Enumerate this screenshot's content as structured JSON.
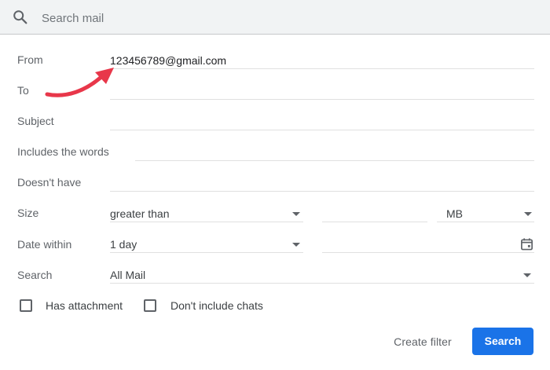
{
  "search": {
    "placeholder": "Search mail"
  },
  "fields": {
    "from": {
      "label": "From",
      "value": "123456789@gmail.com"
    },
    "to": {
      "label": "To",
      "value": ""
    },
    "subject": {
      "label": "Subject",
      "value": ""
    },
    "includes": {
      "label": "Includes the words",
      "value": ""
    },
    "doesnt_have": {
      "label": "Doesn't have",
      "value": ""
    },
    "size": {
      "label": "Size",
      "operator": "greater than",
      "value": "",
      "unit": "MB"
    },
    "date": {
      "label": "Date within",
      "range": "1 day",
      "value": ""
    },
    "search_in": {
      "label": "Search",
      "value": "All Mail"
    }
  },
  "checkboxes": {
    "has_attachment": {
      "label": "Has attachment",
      "checked": false
    },
    "no_chats": {
      "label": "Don't include chats",
      "checked": false
    }
  },
  "buttons": {
    "create_filter": "Create filter",
    "search": "Search"
  },
  "annotation": {
    "arrow_color": "#e8374a"
  },
  "colors": {
    "primary": "#1a73e8",
    "searchbar_bg": "#f1f3f4"
  }
}
